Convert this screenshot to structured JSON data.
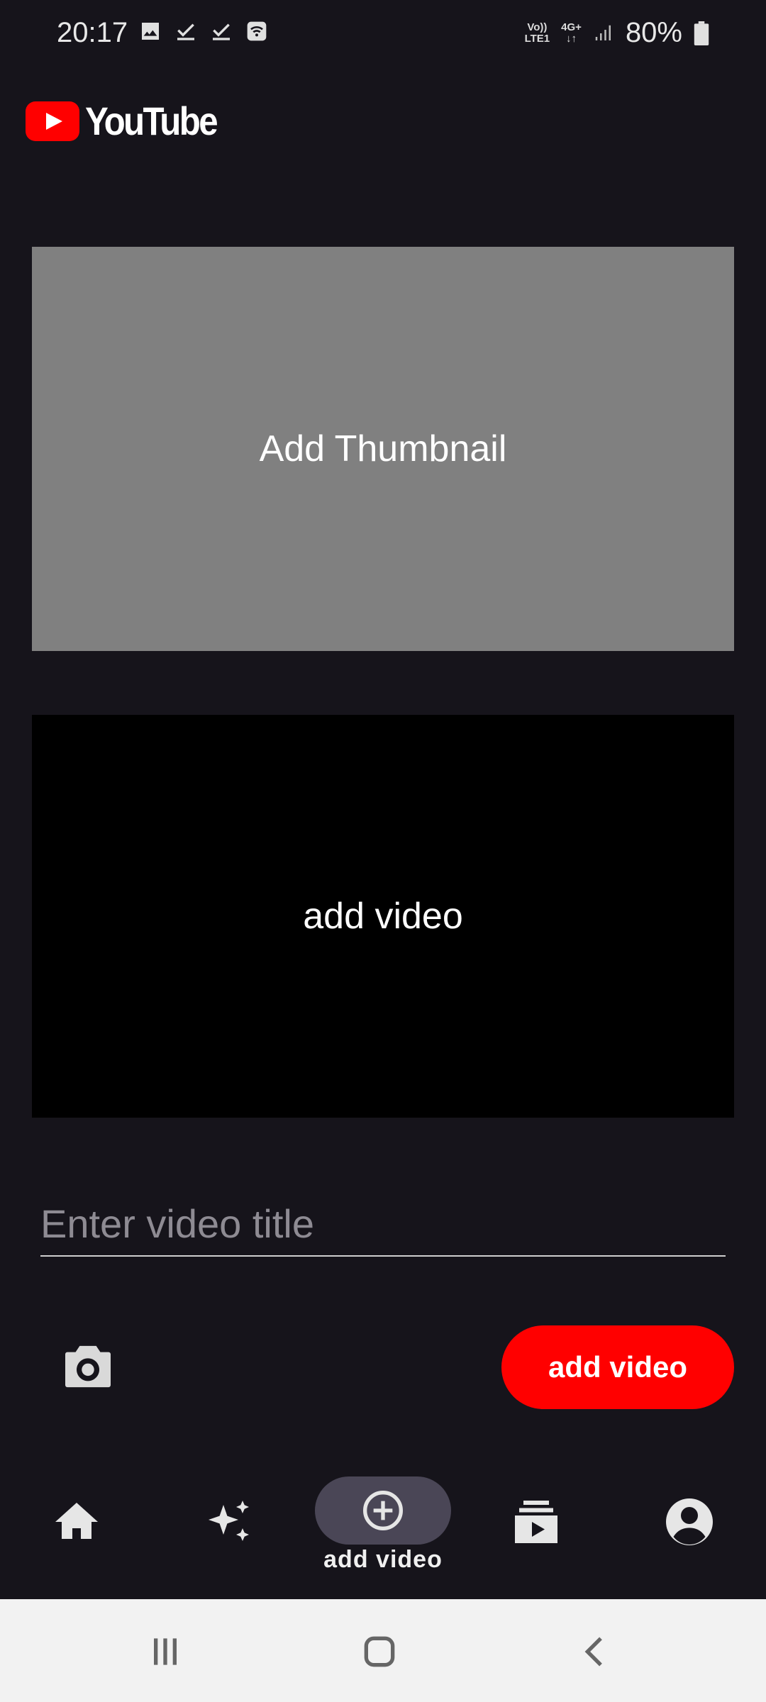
{
  "status_bar": {
    "time": "20:17",
    "volte_top": "Vo))",
    "volte_bottom": "LTE1",
    "network": "4G+",
    "battery": "80%"
  },
  "header": {
    "brand": "YouTube",
    "brand_color": "#ff0000"
  },
  "thumbnail": {
    "label": "Add Thumbnail"
  },
  "video": {
    "label": "add video"
  },
  "title_field": {
    "placeholder": "Enter video title",
    "value": ""
  },
  "actions": {
    "camera_icon": "camera-icon",
    "add_button_label": "add video",
    "add_button_color": "#ff0000"
  },
  "bottom_nav": {
    "items": [
      {
        "icon": "home-icon",
        "label": ""
      },
      {
        "icon": "sparkle-icon",
        "label": ""
      },
      {
        "icon": "add-circle-icon",
        "label": "add video",
        "active": true
      },
      {
        "icon": "subscriptions-icon",
        "label": ""
      },
      {
        "icon": "account-icon",
        "label": ""
      }
    ]
  },
  "system_nav": {
    "recents_icon": "recents-icon",
    "home_icon": "home-outline-icon",
    "back_icon": "back-icon"
  }
}
